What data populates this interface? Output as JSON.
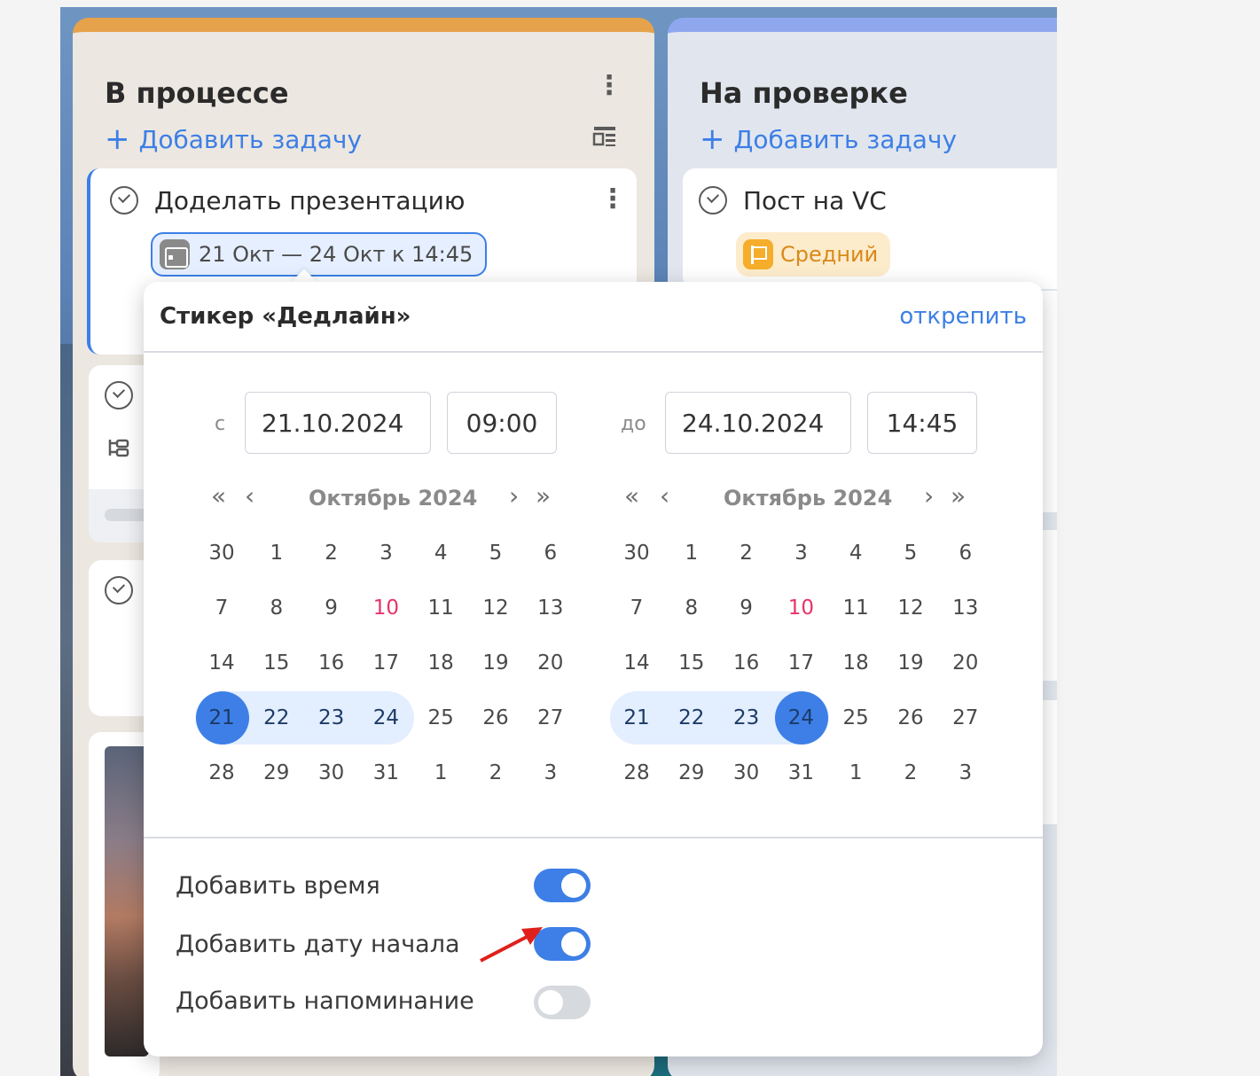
{
  "board": {
    "columns": [
      {
        "title": "В процессе",
        "add_task": "Добавить задачу"
      },
      {
        "title": "На проверке",
        "add_task": "Добавить задачу"
      }
    ]
  },
  "cards": {
    "card1": {
      "title": "Доделать презентацию",
      "deadline": "21 Окт — 24 Окт к 14:45"
    },
    "card2": {
      "title": "Пост на VC",
      "priority": "Средний"
    }
  },
  "popover": {
    "title": "Стикер «Дедлайн»",
    "unpin": "открепить",
    "from_label": "с",
    "from_date": "21.10.2024",
    "from_time": "09:00",
    "to_label": "до",
    "to_date": "24.10.2024",
    "to_time": "14:45",
    "calendars": [
      {
        "month": "Октябрь 2024",
        "weeks": [
          [
            "30",
            "1",
            "2",
            "3",
            "4",
            "5",
            "6"
          ],
          [
            "7",
            "8",
            "9",
            "10",
            "11",
            "12",
            "13"
          ],
          [
            "14",
            "15",
            "16",
            "17",
            "18",
            "19",
            "20"
          ],
          [
            "21",
            "22",
            "23",
            "24",
            "25",
            "26",
            "27"
          ],
          [
            "28",
            "29",
            "30",
            "31",
            "1",
            "2",
            "3"
          ]
        ],
        "selected": "21"
      },
      {
        "month": "Октябрь 2024",
        "weeks": [
          [
            "30",
            "1",
            "2",
            "3",
            "4",
            "5",
            "6"
          ],
          [
            "7",
            "8",
            "9",
            "10",
            "11",
            "12",
            "13"
          ],
          [
            "14",
            "15",
            "16",
            "17",
            "18",
            "19",
            "20"
          ],
          [
            "21",
            "22",
            "23",
            "24",
            "25",
            "26",
            "27"
          ],
          [
            "28",
            "29",
            "30",
            "31",
            "1",
            "2",
            "3"
          ]
        ],
        "selected": "24"
      }
    ],
    "today": "10",
    "range": [
      "21",
      "22",
      "23",
      "24"
    ],
    "options": [
      {
        "label": "Добавить время",
        "on": true
      },
      {
        "label": "Добавить дату начала",
        "on": true
      },
      {
        "label": "Добавить напоминание",
        "on": false
      }
    ]
  },
  "colors": {
    "accent": "#3d7fe6",
    "today": "#e5336b",
    "in_progress": "#e6a24a",
    "review": "#8ea7ef"
  }
}
